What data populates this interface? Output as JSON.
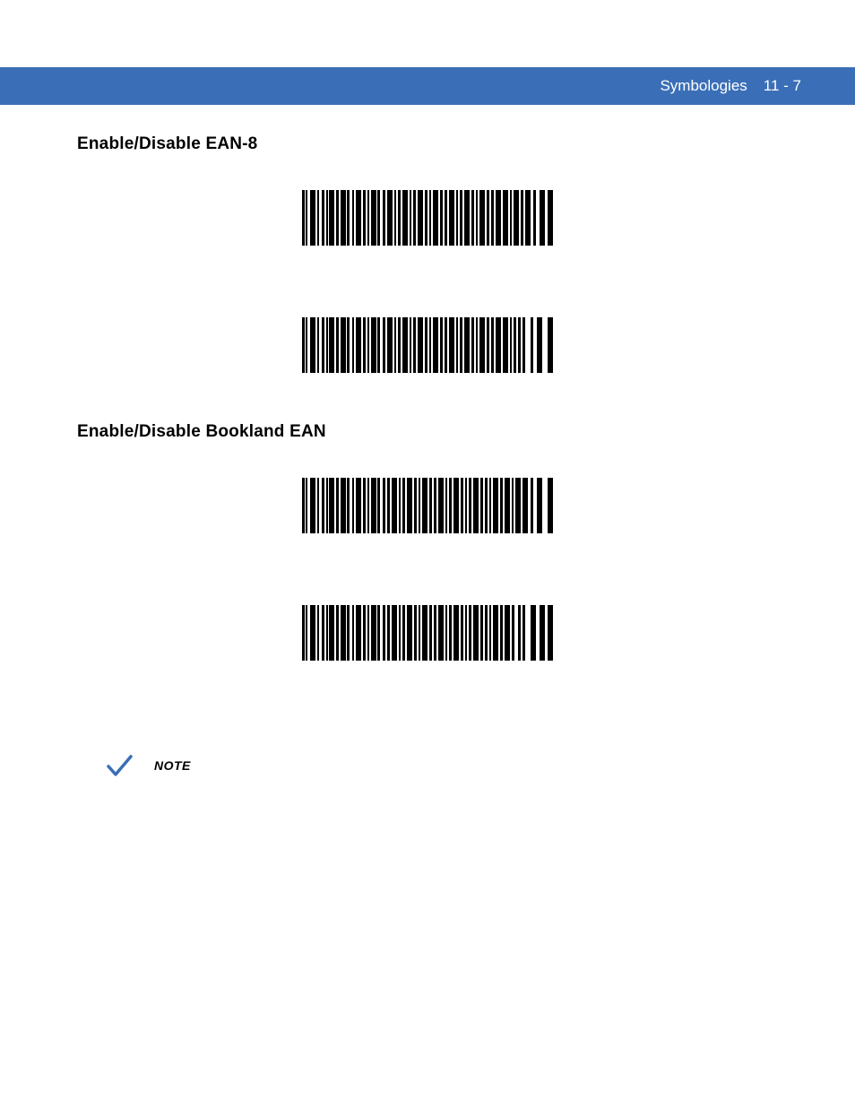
{
  "header": {
    "title": "Symbologies",
    "page": "11 - 7"
  },
  "sections": [
    {
      "heading": "Enable/Disable EAN-8"
    },
    {
      "heading": "Enable/Disable Bookland EAN"
    }
  ],
  "note": {
    "label": "NOTE"
  },
  "barcodes": {
    "bc1_pattern": "10101000100010101010001000100010101000100010001010001010001000101010100010100010001000101010100010",
    "bc2_pattern": "10101000100010101010001000100010101000100010001010001010001000101010001010001000101000100010101010",
    "bc3_pattern": "10101000100010101010001000100010001010100010001000101010001010001010001010100010100010001010101010",
    "bc4_pattern": "10101000100010101010001000100010001010100010001000101010001010001010001010001010001000101000101010"
  }
}
